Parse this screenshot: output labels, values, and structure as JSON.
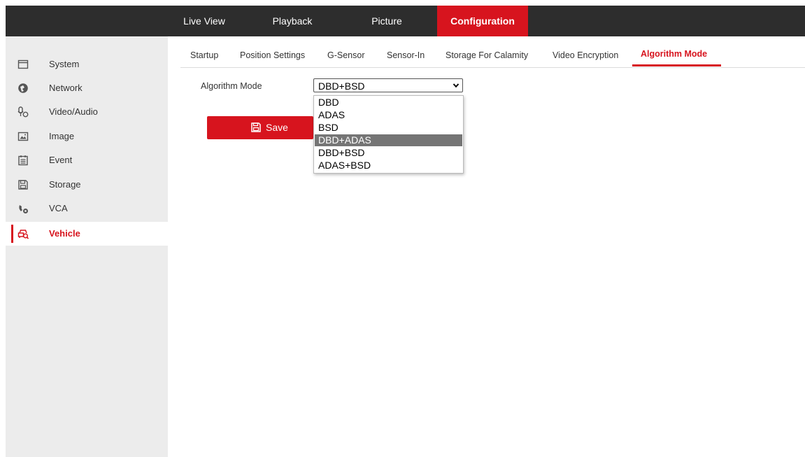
{
  "topnav": {
    "items": [
      {
        "label": "Live View"
      },
      {
        "label": "Playback"
      },
      {
        "label": "Picture"
      },
      {
        "label": "Configuration"
      }
    ],
    "active": "Configuration"
  },
  "sidebar": {
    "items": [
      {
        "label": "System",
        "icon": "system-icon"
      },
      {
        "label": "Network",
        "icon": "network-icon"
      },
      {
        "label": "Video/Audio",
        "icon": "video-audio-icon"
      },
      {
        "label": "Image",
        "icon": "image-icon"
      },
      {
        "label": "Event",
        "icon": "event-icon"
      },
      {
        "label": "Storage",
        "icon": "storage-icon"
      },
      {
        "label": "VCA",
        "icon": "vca-icon"
      },
      {
        "label": "Vehicle",
        "icon": "vehicle-icon"
      }
    ],
    "active": "Vehicle"
  },
  "subtabs": {
    "items": [
      {
        "label": "Startup"
      },
      {
        "label": "Position Settings"
      },
      {
        "label": "G-Sensor"
      },
      {
        "label": "Sensor-In"
      },
      {
        "label": "Storage For Calamity"
      },
      {
        "label": "Video Encryption"
      },
      {
        "label": "Algorithm Mode"
      }
    ],
    "active": "Algorithm Mode"
  },
  "form": {
    "algorithm_label": "Algorithm Mode",
    "algorithm_value": "DBD+BSD",
    "options": [
      "DBD",
      "ADAS",
      "BSD",
      "DBD+ADAS",
      "DBD+BSD",
      "ADAS+BSD"
    ],
    "highlighted_option": "DBD+ADAS",
    "save_label": "Save"
  },
  "colors": {
    "accent": "#d7141e",
    "topbar": "#2d2d2d",
    "sidebar": "#ececec",
    "option_highlight": "#757575"
  }
}
